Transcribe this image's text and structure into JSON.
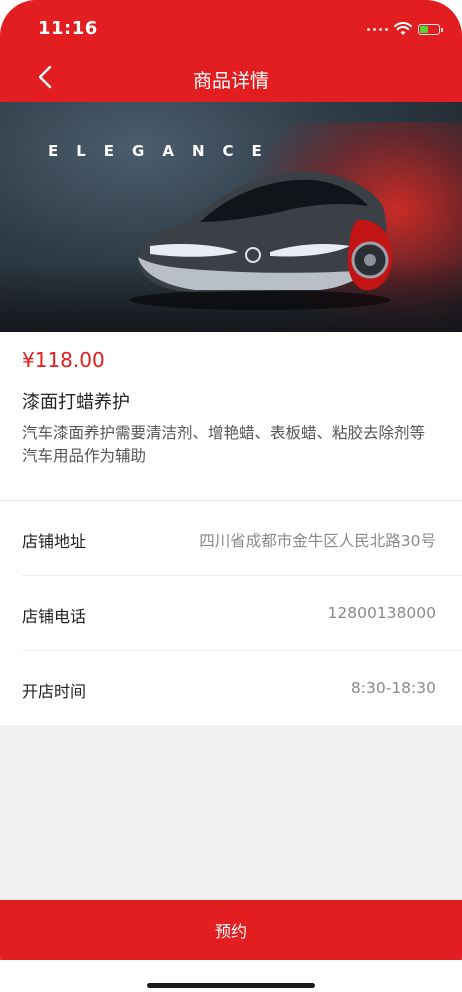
{
  "status": {
    "time": "11:16"
  },
  "header": {
    "title": "商品详情"
  },
  "hero": {
    "word": "ELEGANCE"
  },
  "product": {
    "price": "¥118.00",
    "name": "漆面打蜡养护",
    "description": "汽车漆面养护需要清洁剂、增艳蜡、表板蜡、粘胶去除剂等汽车用品作为辅助"
  },
  "store": {
    "rows": [
      {
        "label": "店铺地址",
        "value": "四川省成都市金牛区人民北路30号"
      },
      {
        "label": "店铺电话",
        "value": "12800138000"
      },
      {
        "label": "开店时间",
        "value": "8:30-18:30"
      }
    ]
  },
  "footer": {
    "book_label": "预约"
  },
  "colors": {
    "accent": "#e21e21",
    "battery": "#5bd33b"
  }
}
